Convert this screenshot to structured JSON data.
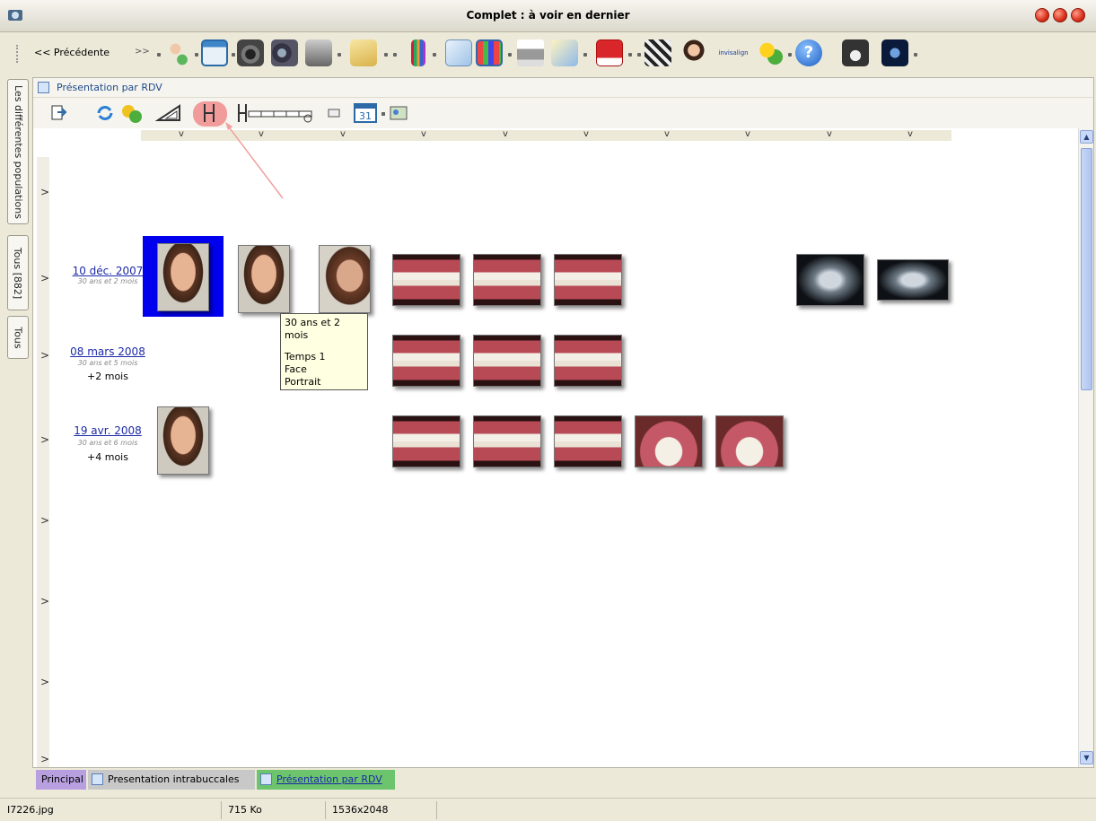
{
  "window": {
    "title": "Complet : à voir en dernier"
  },
  "toolbar": {
    "prev_label": "<< Précédente",
    "next_label": ">>",
    "icons": [
      "patient-icon",
      "window-layout-icon",
      "camera-icon",
      "video-camera-icon",
      "scanner-icon",
      "folder-icon",
      "paint-brushes-icon",
      "notes-icon",
      "grid-icon",
      "printer-icon",
      "email-icon",
      "presentation-icon",
      "clapper-icon",
      "face-icon",
      "invisalign-icon",
      "puzzle-icon",
      "help-icon",
      "tool-icon-1",
      "tool-icon-2"
    ],
    "invisalign_label": "invisalign"
  },
  "left_tabs": [
    {
      "label": "Les différentes populations"
    },
    {
      "label": "Tous [882]"
    },
    {
      "label": "Tous"
    }
  ],
  "panel": {
    "title": "Présentation par RDV"
  },
  "column_markers": [
    "v",
    "v",
    "v",
    "v",
    "v",
    "v",
    "v",
    "v",
    "v",
    "v"
  ],
  "visits": [
    {
      "date": "10 déc. 2007",
      "age": "30 ans et 2 mois",
      "delta": ""
    },
    {
      "date": "08 mars 2008",
      "age": "30 ans et 5 mois",
      "delta": "+2 mois"
    },
    {
      "date": "19 avr. 2008",
      "age": "30 ans et 6 mois",
      "delta": "+4 mois"
    }
  ],
  "row_chevron": ">",
  "tooltip": {
    "line1": "30 ans et 2 mois",
    "line2": "Temps 1",
    "line3": "Face",
    "line4": "Portrait"
  },
  "bottom_tabs": [
    {
      "label": "Principal"
    },
    {
      "label": "Presentation intrabuccales"
    },
    {
      "label": "Présentation par RDV"
    }
  ],
  "status": {
    "filename": "I7226.jpg",
    "size": "715 Ko",
    "dimensions": "1536x2048"
  },
  "colors": {
    "selection": "#0000ee",
    "link": "#1c2aa8",
    "highlight": "#f08c8c",
    "arrow": "#f0a0a0"
  }
}
